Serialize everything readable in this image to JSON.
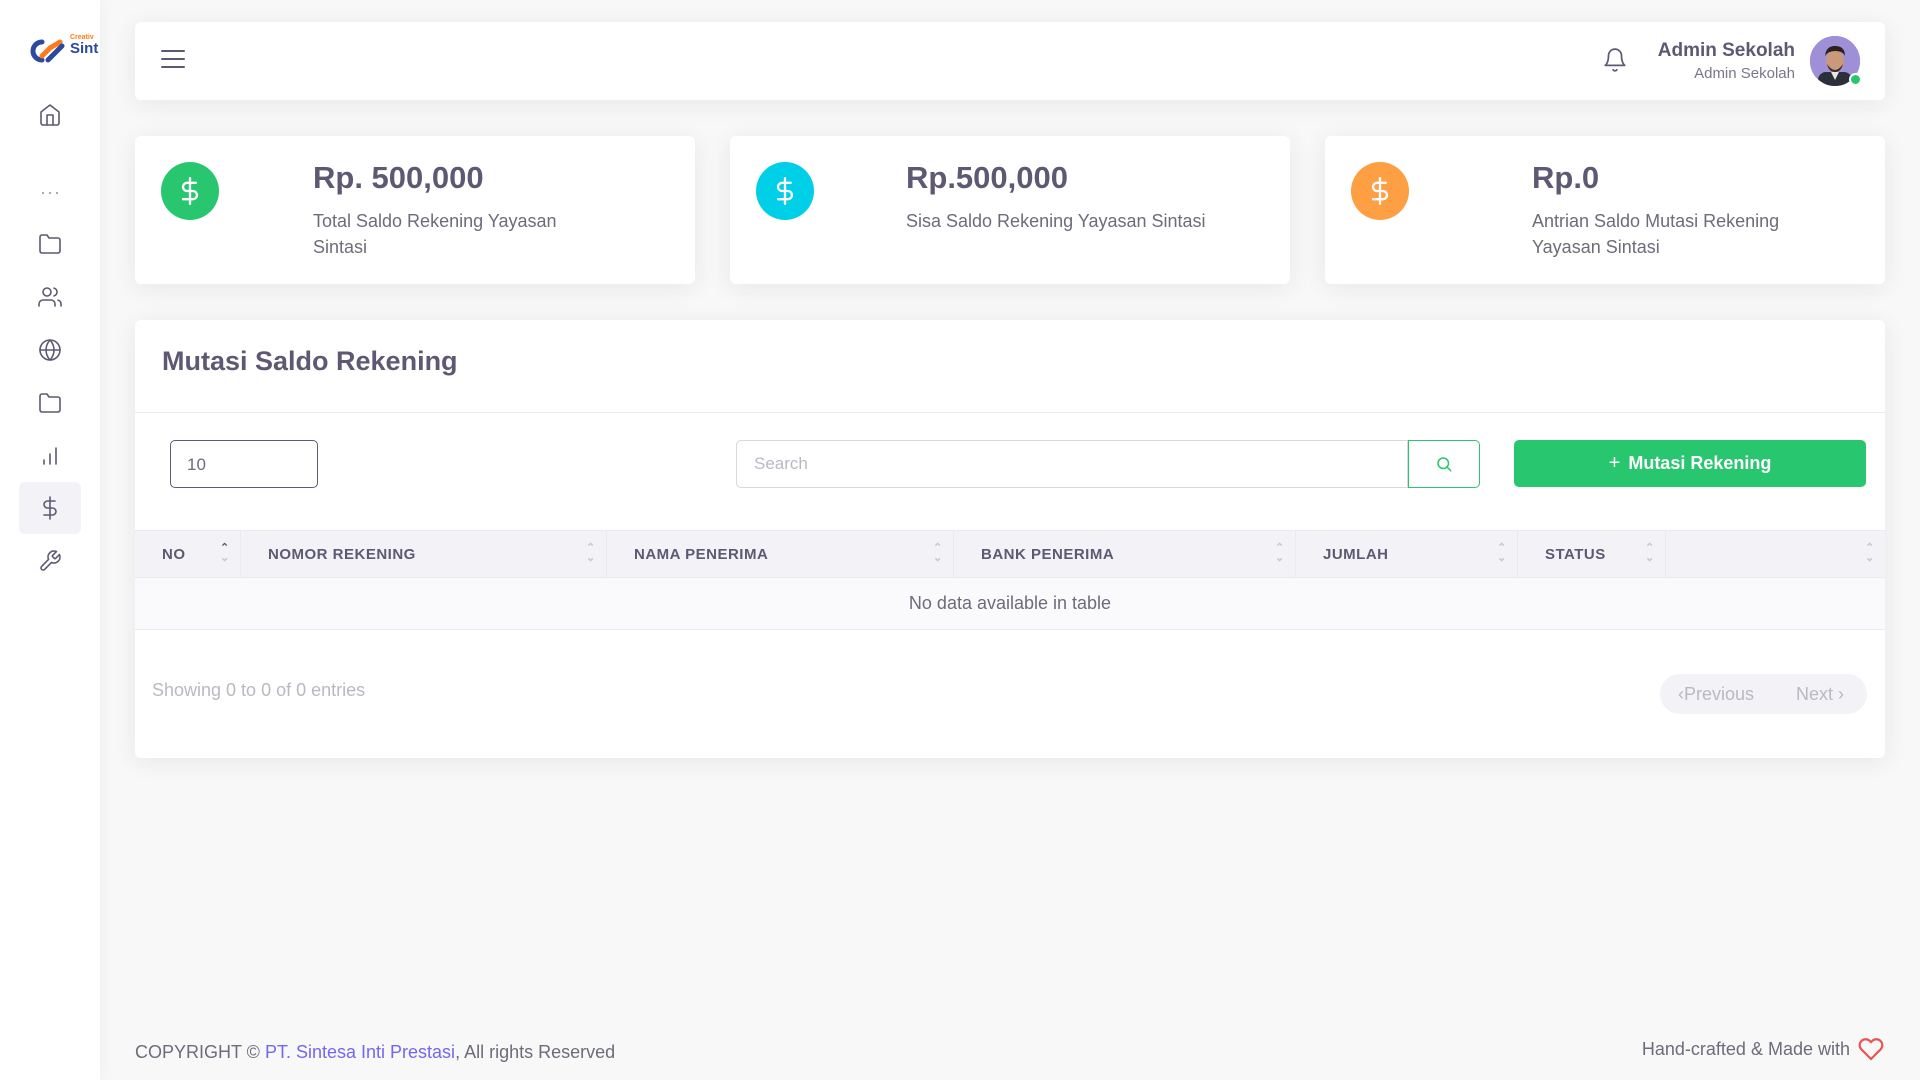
{
  "brand": {
    "logo_small": "Creativ",
    "logo_big": "Sint",
    "colors": {
      "primary": "#7367f0",
      "success": "#28c76f",
      "info": "#00cfe8",
      "warning": "#ff9f43",
      "danger": "#ea5455"
    }
  },
  "sidebar": {
    "items": [
      {
        "icon": "home-icon"
      },
      {
        "icon": "more-horizontal-icon"
      },
      {
        "icon": "folder-icon"
      },
      {
        "icon": "users-icon"
      },
      {
        "icon": "globe-icon"
      },
      {
        "icon": "folder-icon"
      },
      {
        "icon": "bar-chart-icon"
      },
      {
        "icon": "dollar-sign-icon",
        "active": true
      },
      {
        "icon": "tool-icon"
      }
    ]
  },
  "header": {
    "user_name": "Admin Sekolah",
    "user_role": "Admin Sekolah"
  },
  "stats": [
    {
      "value": "Rp. 500,000",
      "label": "Total Saldo Rekening Yayasan Sintasi",
      "color": "#28c76f",
      "icon": "dollar-sign-icon"
    },
    {
      "value": "Rp.500,000",
      "label": "Sisa Saldo Rekening Yayasan Sintasi",
      "color": "#00cfe8",
      "icon": "dollar-sign-icon"
    },
    {
      "value": "Rp.0",
      "label": "Antrian Saldo Mutasi Rekening Yayasan Sintasi",
      "color": "#ff9f43",
      "icon": "dollar-sign-icon"
    }
  ],
  "main": {
    "title": "Mutasi Saldo Rekening",
    "page_length": "10",
    "search_placeholder": "Search",
    "add_button": "Mutasi Rekening",
    "columns": [
      "NO",
      "NOMOR REKENING",
      "NAMA PENERIMA",
      "BANK PENERIMA",
      "JUMLAH",
      "STATUS",
      ""
    ],
    "empty_text": "No data available in table",
    "info": "Showing 0 to 0 of 0 entries",
    "prev": "Previous",
    "next": "Next"
  },
  "footer": {
    "copyright": "COPYRIGHT ©",
    "company": "PT. Sintesa Inti Prestasi",
    "rights": ", All rights Reserved",
    "made_with": "Hand-crafted & Made with"
  }
}
